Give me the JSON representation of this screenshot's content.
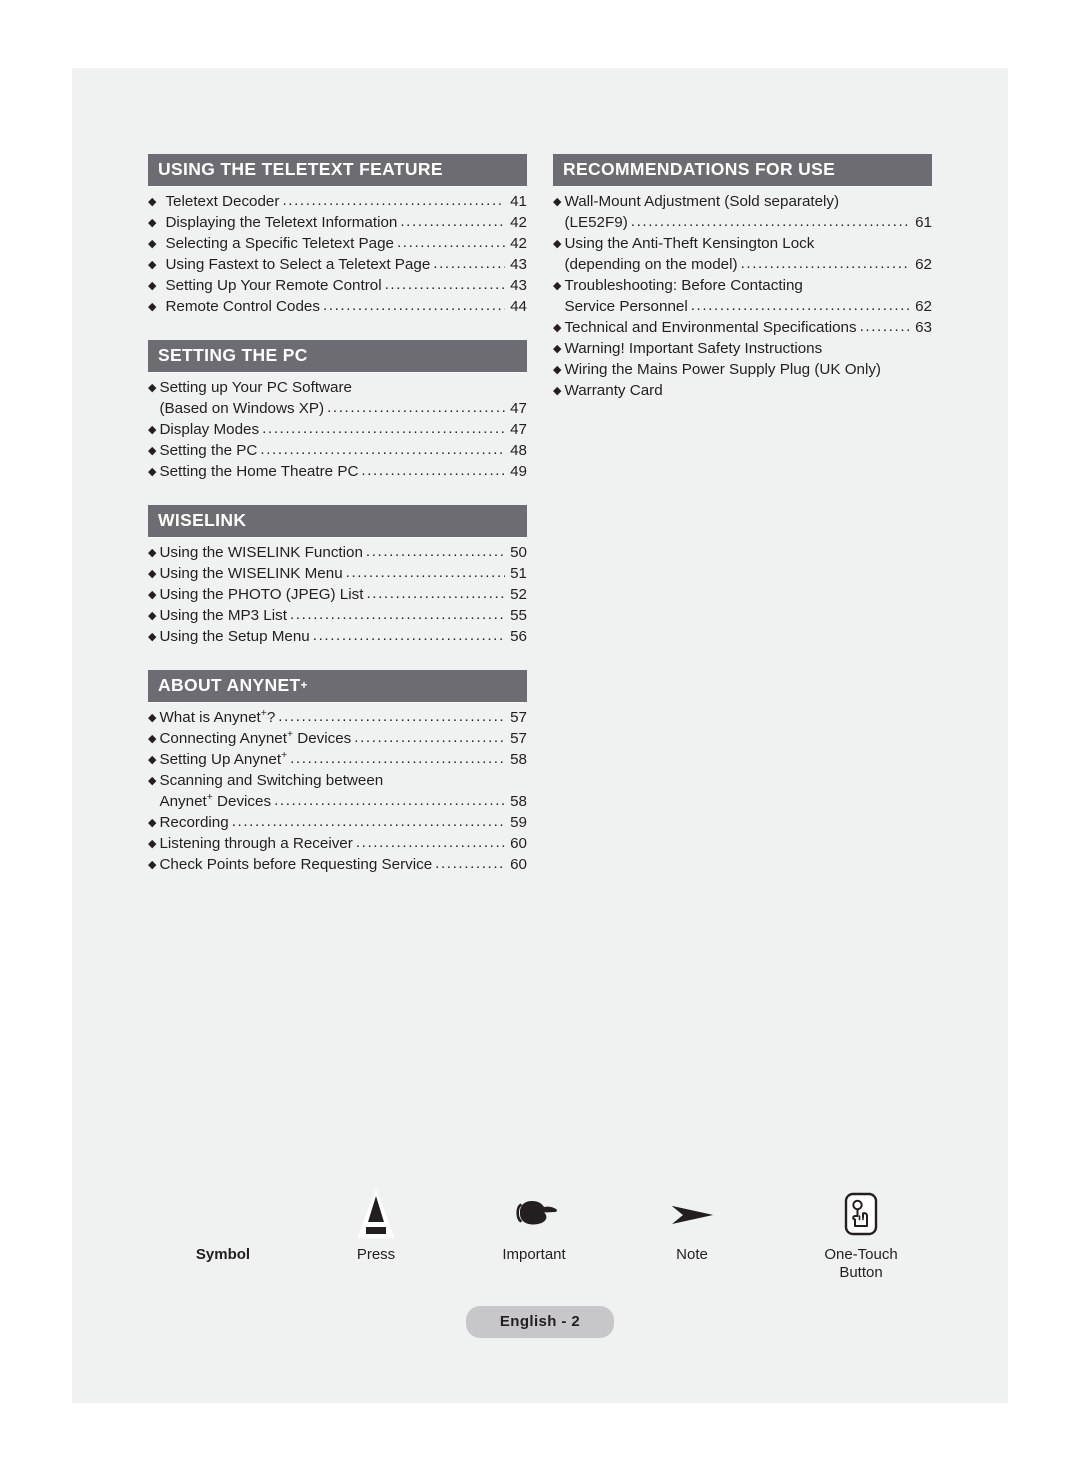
{
  "page": {
    "footer_badge": "English - 2",
    "header_bar_color": "#6c6c72",
    "sheet_color": "#f0f1f1",
    "text_color": "#231f20",
    "badge_color": "#c7c7c9"
  },
  "toc": {
    "left_column": [
      {
        "title": "USING THE TELETEXT FEATURE",
        "title_sup": "",
        "wide_gap": true,
        "entries": [
          {
            "label": "Teletext Decoder",
            "page": "41",
            "cont": false,
            "leader": true
          },
          {
            "label": "Displaying the Teletext Information",
            "page": "42",
            "cont": false,
            "leader": true
          },
          {
            "label": "Selecting a Specific Teletext Page",
            "page": "42",
            "cont": false,
            "leader": true
          },
          {
            "label": "Using Fastext to Select a Teletext Page",
            "page": "43",
            "cont": false,
            "leader": true
          },
          {
            "label": "Setting Up Your Remote Control",
            "page": "43",
            "cont": false,
            "leader": true
          },
          {
            "label": "Remote Control Codes",
            "page": "44",
            "cont": false,
            "leader": true
          }
        ]
      },
      {
        "title": "SETTING THE PC",
        "title_sup": "",
        "wide_gap": false,
        "entries": [
          {
            "label": "Setting up Your PC Software",
            "page": "",
            "cont": false,
            "leader": false
          },
          {
            "label": "(Based on Windows XP)",
            "page": "47",
            "cont": true,
            "leader": true
          },
          {
            "label": "Display Modes",
            "page": "47",
            "cont": false,
            "leader": true
          },
          {
            "label": "Setting the PC",
            "page": "48",
            "cont": false,
            "leader": true
          },
          {
            "label": "Setting the Home Theatre PC",
            "page": "49",
            "cont": false,
            "leader": true
          }
        ]
      },
      {
        "title": "WISELINK",
        "title_sup": "",
        "wide_gap": false,
        "entries": [
          {
            "label": "Using the WISELINK Function",
            "page": "50",
            "cont": false,
            "leader": true
          },
          {
            "label": "Using the WISELINK Menu",
            "page": "51",
            "cont": false,
            "leader": true
          },
          {
            "label": "Using the PHOTO (JPEG) List",
            "page": "52",
            "cont": false,
            "leader": true
          },
          {
            "label": "Using the MP3 List",
            "page": "55",
            "cont": false,
            "leader": true
          },
          {
            "label": "Using the Setup Menu",
            "page": "56",
            "cont": false,
            "leader": true
          }
        ]
      },
      {
        "title": "ABOUT ANYNET",
        "title_sup": "+",
        "wide_gap": false,
        "entries": [
          {
            "label": "What is Anynet",
            "sup": "+",
            "label_after": "?",
            "page": "57",
            "cont": false,
            "leader": true
          },
          {
            "label": "Connecting Anynet",
            "sup": "+",
            "label_after": " Devices",
            "page": "57",
            "cont": false,
            "leader": true
          },
          {
            "label": "Setting Up Anynet",
            "sup": "+",
            "label_after": "",
            "page": "58",
            "cont": false,
            "leader": true
          },
          {
            "label": "Scanning and Switching between",
            "page": "",
            "cont": false,
            "leader": false
          },
          {
            "label": "Anynet",
            "sup": "+",
            "label_after": " Devices",
            "page": "58",
            "cont": true,
            "leader": true
          },
          {
            "label": "Recording",
            "page": "59",
            "cont": false,
            "leader": true
          },
          {
            "label": "Listening through a Receiver",
            "page": "60",
            "cont": false,
            "leader": true
          },
          {
            "label": "Check Points before Requesting Service",
            "page": "60",
            "cont": false,
            "leader": true
          }
        ]
      }
    ],
    "right_column": [
      {
        "title": "RECOMMENDATIONS FOR USE",
        "title_sup": "",
        "wide_gap": false,
        "entries": [
          {
            "label": "Wall-Mount Adjustment (Sold separately)",
            "page": "",
            "cont": false,
            "leader": false
          },
          {
            "label": "(LE52F9)",
            "page": "61",
            "cont": true,
            "leader": true
          },
          {
            "label": "Using the Anti-Theft Kensington Lock",
            "page": "",
            "cont": false,
            "leader": false
          },
          {
            "label": "(depending on the model)",
            "page": "62",
            "cont": true,
            "leader": true
          },
          {
            "label": "Troubleshooting: Before Contacting",
            "page": "",
            "cont": false,
            "leader": false
          },
          {
            "label": "Service Personnel",
            "page": "62",
            "cont": true,
            "leader": true
          },
          {
            "label": "Technical and Environmental Specifications",
            "page": "63",
            "cont": false,
            "leader": true
          },
          {
            "label": "Warning! Important Safety Instructions",
            "page": "",
            "cont": false,
            "leader": false
          },
          {
            "label": "Wiring the Mains Power Supply Plug (UK Only)",
            "page": "",
            "cont": false,
            "leader": false
          },
          {
            "label": "Warranty Card",
            "page": "",
            "cont": false,
            "leader": false
          }
        ]
      }
    ]
  },
  "legend": {
    "symbol_label": "Symbol",
    "items": [
      {
        "icon": "press-triangle-icon",
        "label": "Press"
      },
      {
        "icon": "pointing-hand-icon",
        "label": "Important"
      },
      {
        "icon": "arrow-note-icon",
        "label": "Note"
      },
      {
        "icon": "one-touch-button-icon",
        "label": "One-Touch\nButton"
      }
    ]
  }
}
